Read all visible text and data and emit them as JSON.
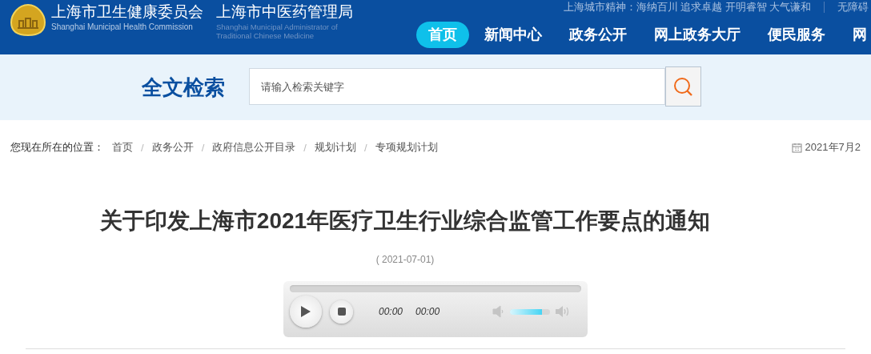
{
  "header": {
    "org_name": "上海市卫生健康委员会",
    "org_name_en": "Shanghai Municipal Health Commission",
    "org2_name": "上海市中医药管理局",
    "org2_name_en": "Shanghai Municipal Administrator of Traditional Chinese Medicine",
    "motto": "上海城市精神：海纳百川 追求卓越 开明睿智 大气谦和",
    "accessibility": "无障碍",
    "nav": [
      {
        "label": "首页",
        "selected": true
      },
      {
        "label": "新闻中心",
        "selected": false
      },
      {
        "label": "政务公开",
        "selected": false
      },
      {
        "label": "网上政务大厅",
        "selected": false
      },
      {
        "label": "便民服务",
        "selected": false
      },
      {
        "label": "网",
        "selected": false
      }
    ]
  },
  "search": {
    "title": "全文检索",
    "placeholder": "请输入检索关键字"
  },
  "breadcrumb": {
    "prefix": "您现在所在的位置：",
    "separator": "/",
    "items": [
      "首页",
      "政务公开",
      "政府信息公开目录",
      "规划计划",
      "专项规划计划"
    ],
    "date": "2021年7月2"
  },
  "article": {
    "title": "关于印发上海市2021年医疗卫生行业综合监管工作要点的通知",
    "date": "( 2021-07-01)"
  },
  "player": {
    "progress": {
      "level": 0
    },
    "current_time": "00:00",
    "duration": "00:00",
    "volume": {
      "level": 0.8
    }
  }
}
